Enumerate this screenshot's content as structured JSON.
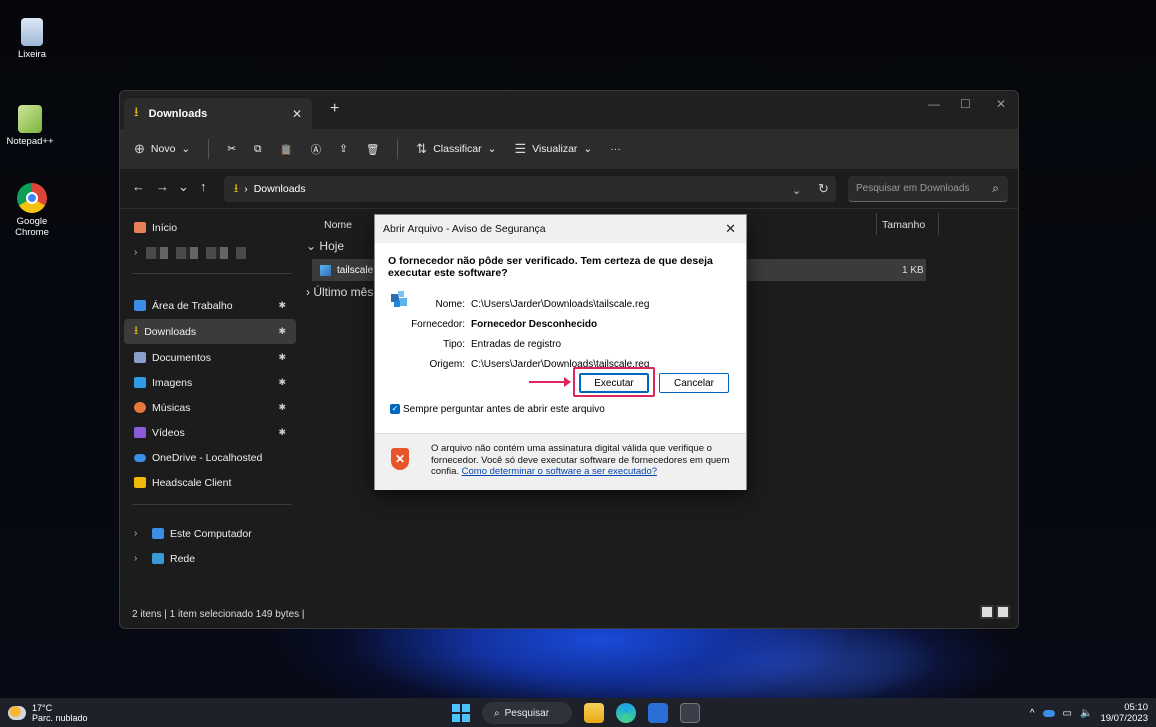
{
  "desktop": {
    "icons": [
      {
        "label": "Lixeira"
      },
      {
        "label": "Notepad++"
      },
      {
        "label": "Google Chrome"
      }
    ]
  },
  "explorer": {
    "tab_title": "Downloads",
    "toolbar": {
      "new_label": "Novo",
      "sort_label": "Classificar",
      "view_label": "Visualizar",
      "more_label": "···"
    },
    "address": {
      "path_label": "Downloads",
      "search_placeholder": "Pesquisar em Downloads"
    },
    "sidebar": {
      "home": "Início",
      "pinned": [
        {
          "label": "Área de Trabalho",
          "color": "#3a8ee6"
        },
        {
          "label": "Downloads",
          "color": "#f1b80a"
        },
        {
          "label": "Documentos",
          "color": "#8aa0c8"
        },
        {
          "label": "Imagens",
          "color": "#2f9be8"
        },
        {
          "label": "Músicas",
          "color": "#e7763a"
        },
        {
          "label": "Vídeos",
          "color": "#8a5cd8"
        },
        {
          "label": "OneDrive - Localhosted",
          "color": "#3a8ee6"
        },
        {
          "label": "Headscale Client",
          "color": "#f1b80a"
        }
      ],
      "computer": "Este Computador",
      "network": "Rede"
    },
    "columns": {
      "name": "Nome",
      "size": "Tamanho"
    },
    "groups": {
      "today": "Hoje",
      "last_month": "Último mês"
    },
    "file": {
      "name": "tailscale",
      "size": "1 KB"
    },
    "status": "2 itens  |  1 item selecionado  149 bytes  |"
  },
  "dialog": {
    "title": "Abrir Arquivo - Aviso de Segurança",
    "question": "O fornecedor não pôde ser verificado. Tem certeza de que deseja executar este software?",
    "fields": {
      "name_key": "Nome:",
      "name_val": "C:\\Users\\Jarder\\Downloads\\tailscale.reg",
      "vendor_key": "Fornecedor:",
      "vendor_val": "Fornecedor Desconhecido",
      "type_key": "Tipo:",
      "type_val": "Entradas de registro",
      "origin_key": "Origem:",
      "origin_val": "C:\\Users\\Jarder\\Downloads\\tailscale.reg"
    },
    "run_label": "Executar",
    "cancel_label": "Cancelar",
    "checkbox_label": "Sempre perguntar antes de abrir este arquivo",
    "warning_text": "O arquivo não contém uma assinatura digital válida que verifique o fornecedor. Você só deve executar software de fornecedores em quem confia.",
    "warning_link": "Como determinar o software a ser executado?"
  },
  "taskbar": {
    "temperature": "17°C",
    "weather": "Parc. nublado",
    "search_label": "Pesquisar",
    "time": "05:10",
    "date": "19/07/2023"
  }
}
